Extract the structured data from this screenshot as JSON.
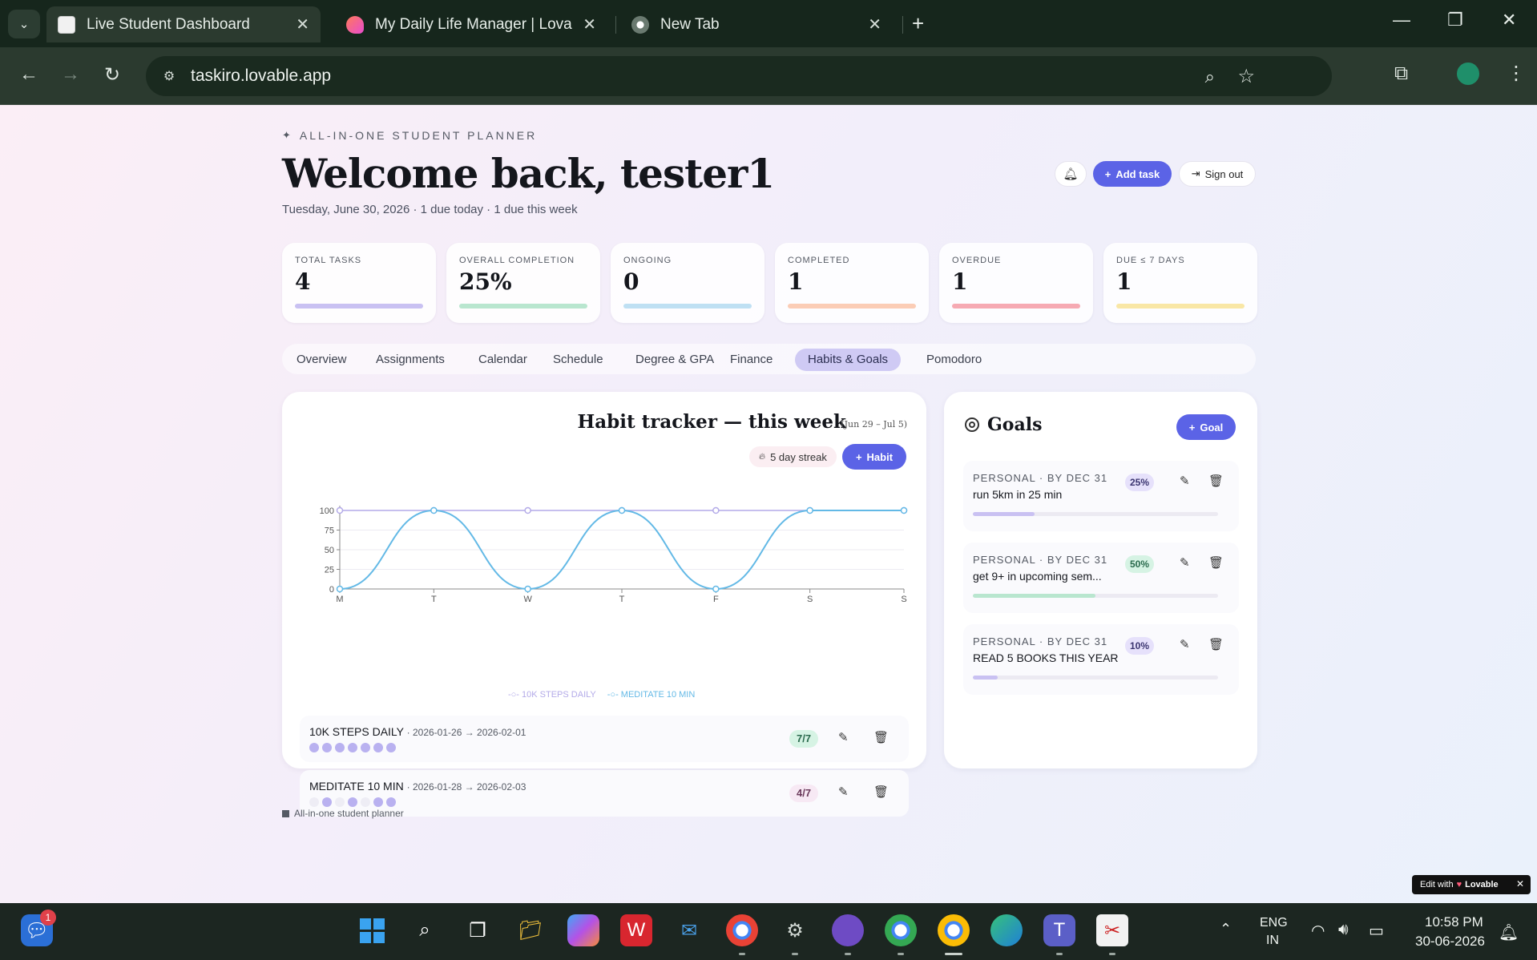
{
  "browser": {
    "tabs": [
      {
        "label": "Live Student Dashboard",
        "active": true
      },
      {
        "label": "My Daily Life Manager | Lovable",
        "active": false
      },
      {
        "label": "New Tab",
        "active": false
      }
    ],
    "url": "taskiro.lovable.app"
  },
  "header": {
    "eyebrow": "ALL-IN-ONE STUDENT PLANNER",
    "welcome": "Welcome back, tester1",
    "subline": "Tuesday, June 30, 2026 · 1 due today · 1 due this week",
    "add_task": "Add task",
    "sign_out": "Sign out"
  },
  "stats": [
    {
      "label": "TOTAL TASKS",
      "value": "4",
      "color": "#c9c1f2"
    },
    {
      "label": "OVERALL COMPLETION",
      "value": "25%",
      "color": "#b9e6cf"
    },
    {
      "label": "ONGOING",
      "value": "0",
      "color": "#bfe0f3"
    },
    {
      "label": "COMPLETED",
      "value": "1",
      "color": "#fbcdb6"
    },
    {
      "label": "OVERDUE",
      "value": "1",
      "color": "#f6aab3"
    },
    {
      "label": "DUE ≤ 7 DAYS",
      "value": "1",
      "color": "#f9e7a6"
    }
  ],
  "nav_tabs": [
    "Overview",
    "Assignments",
    "Calendar",
    "Schedule",
    "Degree & GPA",
    "Finance",
    "Habits & Goals",
    "Pomodoro"
  ],
  "active_tab": "Habits & Goals",
  "habit_tracker": {
    "title": "Habit tracker — this week",
    "range": "(Jun 29 – Jul 5)",
    "streak": "5 day streak",
    "add_habit": "Habit",
    "habits": [
      {
        "name": "10K STEPS DAILY",
        "dates": "· 2026-01-26 → 2026-02-01",
        "count": "7/7",
        "done": [
          true,
          true,
          true,
          true,
          true,
          true,
          true
        ]
      },
      {
        "name": "MEDITATE 10 MIN",
        "dates": "· 2026-01-28 → 2026-02-03",
        "count": "4/7",
        "done": [
          false,
          true,
          false,
          true,
          false,
          true,
          true
        ]
      }
    ]
  },
  "chart_data": {
    "type": "line",
    "categories": [
      "M",
      "T",
      "W",
      "T",
      "F",
      "S",
      "S"
    ],
    "series": [
      {
        "name": "10K STEPS DAILY",
        "values": [
          100,
          100,
          100,
          100,
          100,
          100,
          100
        ],
        "color": "#b3aae8"
      },
      {
        "name": "MEDITATE 10 MIN",
        "values": [
          0,
          100,
          0,
          100,
          0,
          100,
          100
        ],
        "color": "#63b9e6"
      }
    ],
    "yticks": [
      0,
      25,
      50,
      75,
      100
    ],
    "ylim": [
      0,
      100
    ],
    "grid": true,
    "legend": "bottom"
  },
  "goals": {
    "title": "Goals",
    "add_goal": "Goal",
    "items": [
      {
        "meta": "PERSONAL · BY DEC 31",
        "name": "run 5km in 25 min",
        "pct_label": "25%",
        "progress": 0.25,
        "color": "#c9c1f2",
        "badge_bg": "#e6e1fb",
        "badge_fg": "#3b3570"
      },
      {
        "meta": "PERSONAL · BY DEC 31",
        "name": "get 9+ in upcoming sem...",
        "pct_label": "50%",
        "progress": 0.5,
        "color": "#b9e6cf",
        "badge_bg": "#d6f3e4",
        "badge_fg": "#2a6a4d"
      },
      {
        "meta": "PERSONAL · BY DEC 31",
        "name": "READ 5 BOOKS THIS YEAR",
        "pct_label": "10%",
        "progress": 0.1,
        "color": "#c9c1f2",
        "badge_bg": "#e6e1fb",
        "badge_fg": "#3b3570"
      }
    ]
  },
  "footer_note": "All-in-one student planner",
  "lovable_badge": {
    "prefix": "Edit with",
    "brand": "Lovable"
  },
  "taskbar": {
    "chat_badge": "1",
    "lang": "ENG",
    "region": "IN",
    "time": "10:58 PM",
    "date": "30-06-2026"
  }
}
